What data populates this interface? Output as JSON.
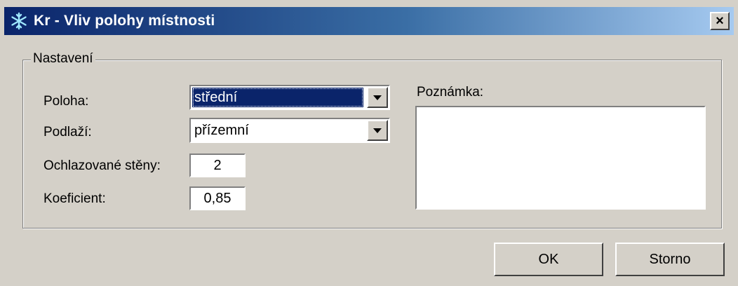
{
  "window": {
    "title": "Kr - Vliv polohy místnosti",
    "close_label": "×"
  },
  "group": {
    "label": "Nastavení"
  },
  "fields": {
    "poloha_label": "Poloha:",
    "poloha_value": "střední",
    "podlazi_label": "Podlaží:",
    "podlazi_value": "přízemní",
    "steny_label": "Ochlazované stěny:",
    "steny_value": "2",
    "koeficient_label": "Koeficient:",
    "koeficient_value": "0,85",
    "poznamka_label": "Poznámka:",
    "poznamka_value": ""
  },
  "buttons": {
    "ok": "OK",
    "cancel": "Storno"
  },
  "icons": {
    "title_icon": "snowflake-icon",
    "dropdown_icon": "chevron-down-icon"
  },
  "colors": {
    "titlebar_start": "#0a246a",
    "titlebar_end": "#a6caf0",
    "face": "#d4d0c8",
    "selection": "#0a246a"
  }
}
